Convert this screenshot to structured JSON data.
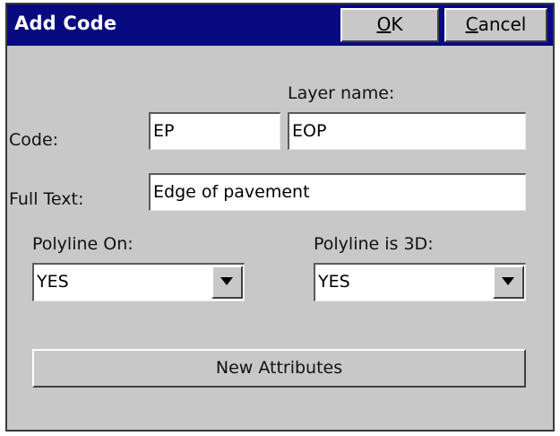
{
  "dialog": {
    "title": "Add Code",
    "ok_label": "OK",
    "ok_accel": "O",
    "ok_rest": "K",
    "cancel_label": "Cancel",
    "cancel_accel": "C",
    "cancel_rest": "ancel"
  },
  "form": {
    "code_label": "Code:",
    "code_value": "EP",
    "layer_name_label": "Layer name:",
    "layer_name_value": "EOP",
    "full_text_label": "Full Text:",
    "full_text_value": "Edge of pavement",
    "polyline_on_label": "Polyline On:",
    "polyline_on_value": "YES",
    "polyline_3d_label": "Polyline is 3D:",
    "polyline_3d_value": "YES",
    "new_attributes_label": "New Attributes"
  },
  "icons": {
    "dropdown": "triangle-down-icon"
  }
}
